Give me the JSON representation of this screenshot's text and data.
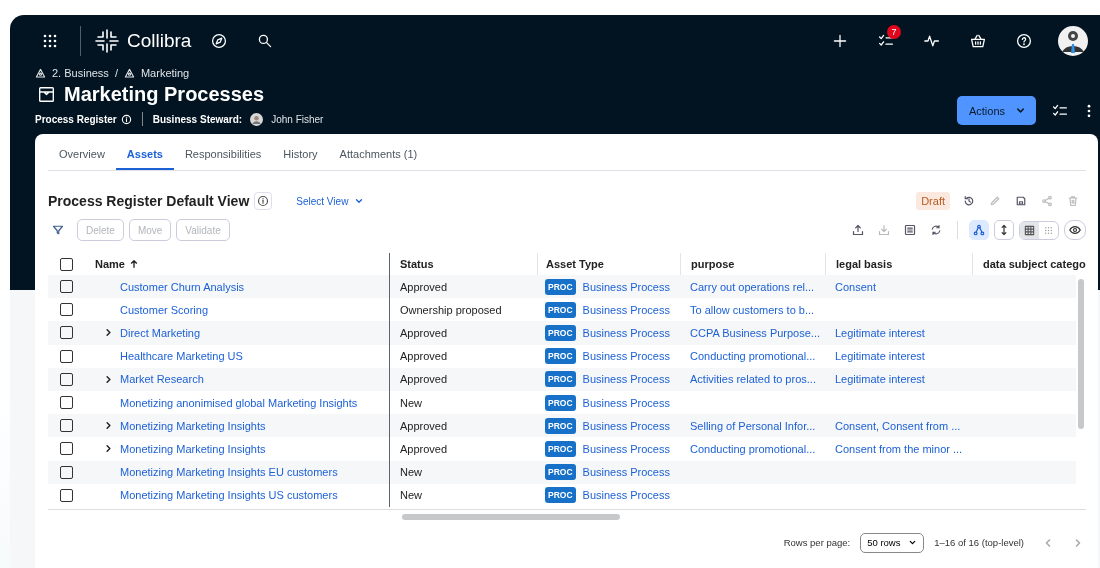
{
  "nav": {
    "logo": "Collibra",
    "notification_count": "7"
  },
  "breadcrumb": [
    "2. Business",
    "Marketing"
  ],
  "breadcrumb_separator": "/",
  "page": {
    "title": "Marketing Processes",
    "asset_type": "Process Register",
    "steward_label": "Business Steward:",
    "steward_name": "John Fisher",
    "actions_button": "Actions"
  },
  "tabs": [
    {
      "label": "Overview",
      "selected": false
    },
    {
      "label": "Assets",
      "selected": true
    },
    {
      "label": "Responsibilities",
      "selected": false
    },
    {
      "label": "History",
      "selected": false
    },
    {
      "label": "Attachments (1)",
      "selected": false
    }
  ],
  "view": {
    "title": "Process Register Default View",
    "select_view": "Select View",
    "status_badge": "Draft"
  },
  "toolbar_buttons": [
    {
      "label": "Delete",
      "disabled": true
    },
    {
      "label": "Move",
      "disabled": true
    },
    {
      "label": "Validate",
      "disabled": true
    }
  ],
  "view_modes": [
    {
      "kind": "grid",
      "selected": true
    },
    {
      "kind": "dots",
      "selected": false
    }
  ],
  "table": {
    "select_all_checked": false,
    "columns": [
      {
        "label": "Name",
        "sorted": true
      },
      {
        "label": "Status",
        "sorted": false
      },
      {
        "label": "Asset Type",
        "sorted": false
      },
      {
        "label": "purpose",
        "sorted": false
      },
      {
        "label": "legal basis",
        "sorted": false
      },
      {
        "label": "data subject catego",
        "sorted": false
      }
    ],
    "rows": [
      {
        "name": "Customer Churn Analysis",
        "expandable": false,
        "checked": false,
        "status": "Approved",
        "badge": "PROC",
        "asset_type": "Business Process",
        "purpose": "Carry out operations rel...",
        "legal_basis": "Consent"
      },
      {
        "name": "Customer Scoring",
        "expandable": false,
        "checked": false,
        "status": "Ownership proposed",
        "badge": "PROC",
        "asset_type": "Business Process",
        "purpose": "To allow customers to b..."
      },
      {
        "name": "Direct Marketing",
        "expandable": true,
        "checked": false,
        "status": "Approved",
        "badge": "PROC",
        "asset_type": "Business Process",
        "purpose": "CCPA Business Purpose...",
        "legal_basis": "Legitimate interest"
      },
      {
        "name": "Healthcare Marketing US",
        "expandable": false,
        "checked": false,
        "status": "Approved",
        "badge": "PROC",
        "asset_type": "Business Process",
        "purpose": "Conducting promotional...",
        "legal_basis": "Legitimate interest"
      },
      {
        "name": "Market Research",
        "expandable": true,
        "checked": false,
        "status": "Approved",
        "badge": "PROC",
        "asset_type": "Business Process",
        "purpose": "Activities related to pros...",
        "legal_basis": "Legitimate interest"
      },
      {
        "name": "Monetizing anonimised global Marketing Insights",
        "expandable": false,
        "checked": false,
        "status": "New",
        "badge": "PROC",
        "asset_type": "Business Process"
      },
      {
        "name": "Monetizing Marketing Insights",
        "expandable": true,
        "checked": false,
        "status": "Approved",
        "badge": "PROC",
        "asset_type": "Business Process",
        "purpose": "Selling of Personal Infor...",
        "legal_basis": "Consent,  Consent from ..."
      },
      {
        "name": "Monetizing Marketing Insights",
        "expandable": true,
        "checked": false,
        "status": "Approved",
        "badge": "PROC",
        "asset_type": "Business Process",
        "purpose": "Conducting promotional...",
        "legal_basis": "Consent from the minor ..."
      },
      {
        "name": "Monetizing Marketing Insights EU customers",
        "expandable": false,
        "checked": false,
        "status": "New",
        "badge": "PROC",
        "asset_type": "Business Process"
      },
      {
        "name": "Monetizing Marketing Insights US customers",
        "expandable": false,
        "checked": false,
        "status": "New",
        "badge": "PROC",
        "asset_type": "Business Process"
      }
    ]
  },
  "pagination": {
    "rows_per_page_label": "Rows per page:",
    "rows_per_page": "50 rows",
    "range": "1–16 of 16 (top-level)"
  }
}
